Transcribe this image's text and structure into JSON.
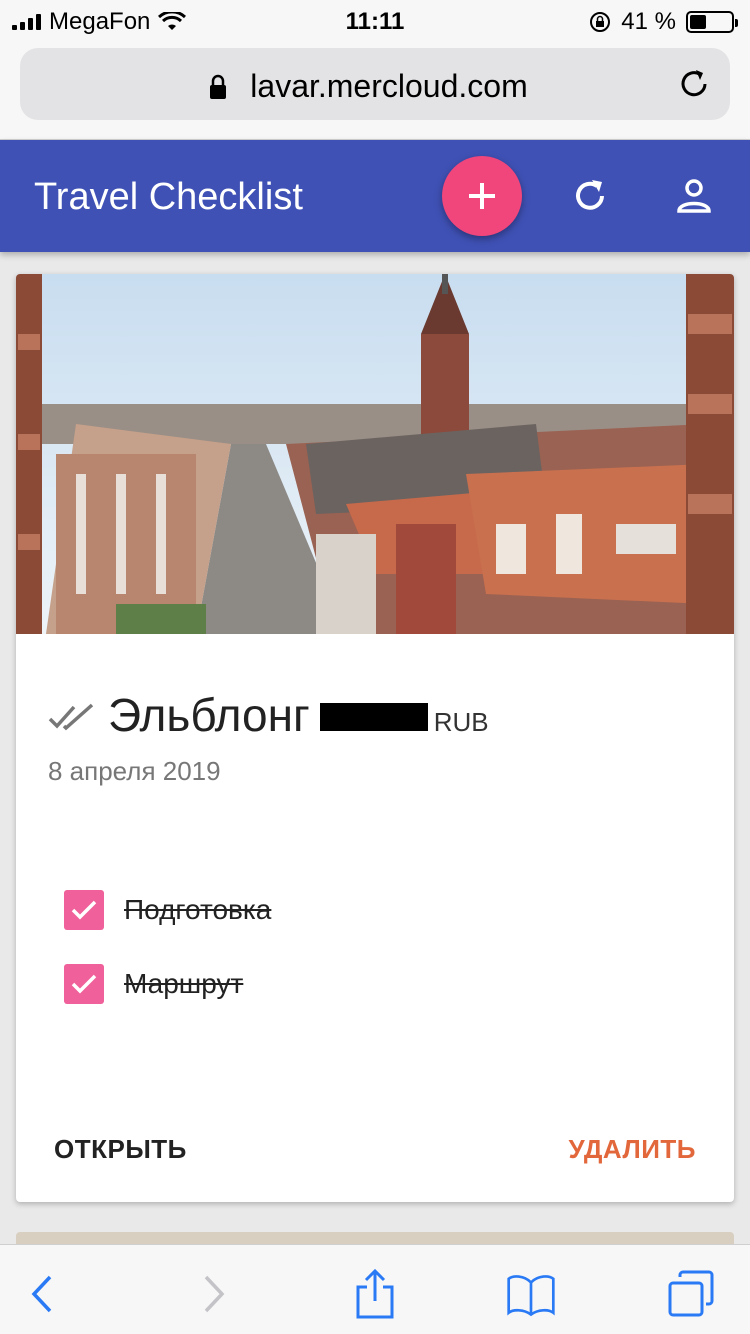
{
  "status_bar": {
    "carrier": "MegaFon",
    "time": "11:11",
    "battery_percent": "41 %",
    "battery_level": 0.41
  },
  "browser": {
    "url": "lavar.mercloud.com"
  },
  "app_bar": {
    "title": "Travel Checklist",
    "icons": [
      "add-icon",
      "refresh-icon",
      "account-icon"
    ],
    "color": "#3f51b5",
    "fab_color": "#f0467b"
  },
  "card": {
    "place": "Эльблонг",
    "currency": "RUB",
    "date": "8 апреля 2019",
    "todos": [
      {
        "label": "Подготовка",
        "checked": true
      },
      {
        "label": "Маршрут",
        "checked": true
      }
    ],
    "open_label": "ОТКРЫТЬ",
    "delete_label": "УДАЛИТЬ",
    "accent_color": "#e2673b",
    "checkbox_color": "#f0609a"
  },
  "toolbar": {
    "icons": [
      "back-icon",
      "forward-icon",
      "share-icon",
      "bookmarks-icon",
      "tabs-icon"
    ]
  }
}
